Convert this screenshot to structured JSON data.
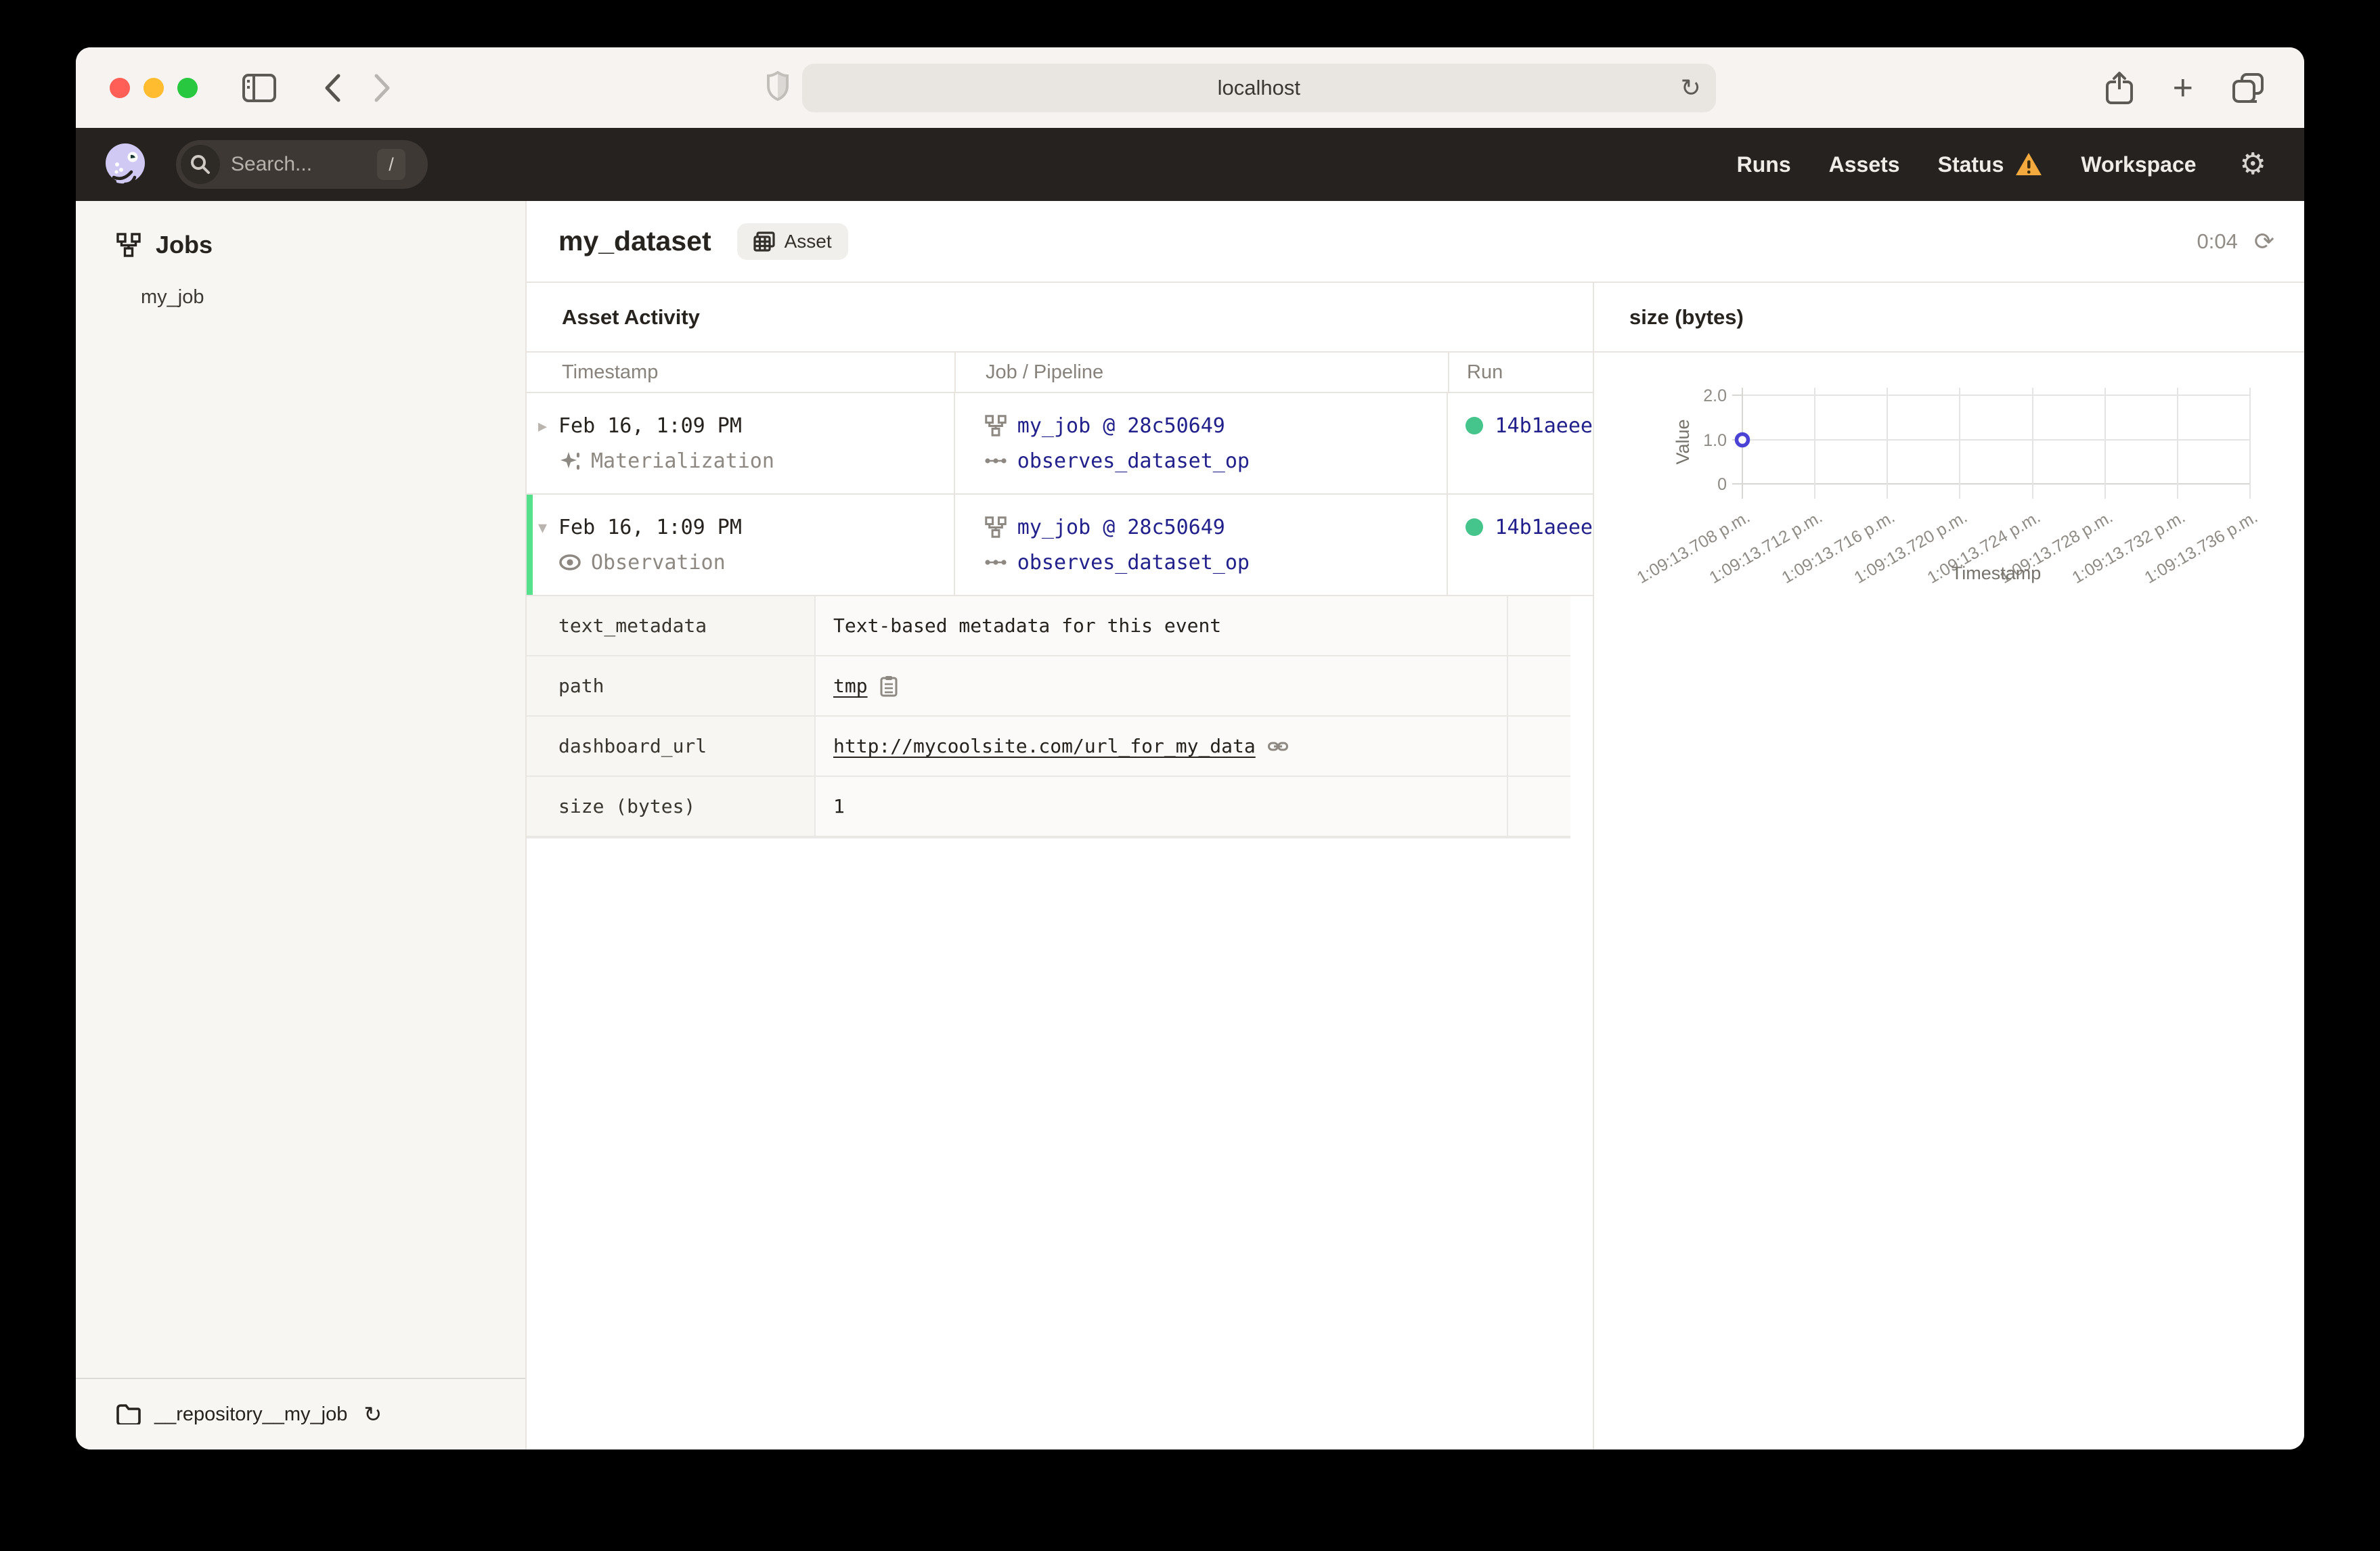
{
  "browser": {
    "url": "localhost",
    "reload_glyph": "↻",
    "plus_glyph": "+"
  },
  "topbar": {
    "search": {
      "placeholder": "Search...",
      "shortcut": "/"
    },
    "nav": {
      "runs": "Runs",
      "assets": "Assets",
      "status": "Status",
      "workspace": "Workspace"
    },
    "gear_glyph": "⚙"
  },
  "sidebar": {
    "title": "Jobs",
    "items": [
      {
        "label": "my_job"
      }
    ],
    "footer": {
      "repository": "__repository__my_job",
      "reload_glyph": "↻"
    }
  },
  "main": {
    "title": "my_dataset",
    "tag": "Asset",
    "timer": "0:04",
    "timer_reload_glyph": "⟳",
    "activity": {
      "heading": "Asset Activity",
      "columns": {
        "timestamp": "Timestamp",
        "job": "Job / Pipeline",
        "run": "Run"
      },
      "rows": [
        {
          "caret": "▸",
          "timestamp": "Feb 16, 1:09 PM",
          "event_type": "Materialization",
          "job": "my_job @ 28c50649",
          "op": "observes_dataset_op",
          "run_id": "14b1aeee",
          "expanded": false
        },
        {
          "caret": "▾",
          "timestamp": "Feb 16, 1:09 PM",
          "event_type": "Observation",
          "job": "my_job @ 28c50649",
          "op": "observes_dataset_op",
          "run_id": "14b1aeee",
          "expanded": true
        }
      ],
      "metadata": [
        {
          "key": "text_metadata",
          "value": "Text-based metadata for this event"
        },
        {
          "key": "path",
          "value": "tmp"
        },
        {
          "key": "dashboard_url",
          "value": "http://mycoolsite.com/url_for_my_data"
        },
        {
          "key": "size (bytes)",
          "value": "1"
        }
      ]
    }
  },
  "chart_data": {
    "type": "scatter",
    "title": "size (bytes)",
    "xlabel": "Timestamp",
    "ylabel": "Value",
    "ylim": [
      0,
      2
    ],
    "y_ticks": [
      "2.0",
      "1.0",
      "0"
    ],
    "x_labels": [
      "1:09:13.708 p.m.",
      "1:09:13.712 p.m.",
      "1:09:13.716 p.m.",
      "1:09:13.720 p.m.",
      "1:09:13.724 p.m.",
      "1:09:13.728 p.m.",
      "1:09:13.732 p.m.",
      "1:09:13.736 p.m."
    ],
    "series": [
      {
        "name": "size (bytes)",
        "points": [
          {
            "x": "1:09:13.708 p.m.",
            "y": 1
          }
        ]
      }
    ],
    "grid": true,
    "legend": "none"
  },
  "colors": {
    "link_navy": "#22218c",
    "run_green": "#45c48c",
    "expanded_border_green": "#55e18b",
    "warning_yellow": "#f3a93d",
    "point_purple": "#4b42d6",
    "topbar_dark": "#262220"
  }
}
